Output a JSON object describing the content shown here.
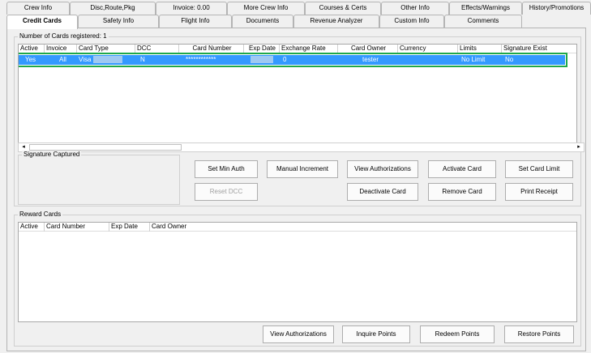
{
  "tabs_top": [
    {
      "label": "Crew Info",
      "active": false
    },
    {
      "label": "Disc,Route,Pkg",
      "active": false
    },
    {
      "label": "Invoice: 0.00",
      "active": false
    },
    {
      "label": "More Crew Info",
      "active": false
    },
    {
      "label": "Courses & Certs",
      "active": false
    },
    {
      "label": "Other Info",
      "active": false
    },
    {
      "label": "Effects/Warnings",
      "active": false
    },
    {
      "label": "History/Promotions",
      "active": false
    }
  ],
  "tabs_bottom": [
    {
      "label": "Credit Cards",
      "active": true
    },
    {
      "label": "Safety Info",
      "active": false
    },
    {
      "label": "Flight Info",
      "active": false
    },
    {
      "label": "Documents",
      "active": false
    },
    {
      "label": "Revenue Analyzer",
      "active": false
    },
    {
      "label": "Custom Info",
      "active": false
    },
    {
      "label": "Comments",
      "active": false
    }
  ],
  "cards_group": {
    "title": "Number of Cards registered: 1",
    "columns": [
      "Active",
      "Invoice",
      "Card Type",
      "DCC",
      "Card Number",
      "Exp Date",
      "Exchange Rate",
      "Card Owner",
      "Currency",
      "Limits",
      "Signature Exist"
    ],
    "rows": [
      {
        "active": "Yes",
        "invoice": "All",
        "card_type": "Visa",
        "dcc": "N",
        "card_number": "************",
        "exp_date": "",
        "exchange_rate": "0",
        "card_owner": "tester",
        "currency": "",
        "limits": "No Limit",
        "signature": "No"
      }
    ]
  },
  "signature": {
    "title": "Signature Captured"
  },
  "buttons": {
    "set_min_auth": "Set Min Auth",
    "manual_increment": "Manual Increment",
    "view_authorizations": "View Authorizations",
    "activate_card": "Activate Card",
    "set_card_limit": "Set Card Limit",
    "reset_dcc": "Reset DCC",
    "deactivate_card": "Deactivate Card",
    "remove_card": "Remove Card",
    "print_receipt": "Print Receipt"
  },
  "reward_group": {
    "title": "Reward Cards",
    "columns": [
      "Active",
      "Card Number",
      "Exp Date",
      "Card Owner"
    ]
  },
  "reward_buttons": {
    "view_authorizations": "View Authorizations",
    "inquire_points": "Inquire Points",
    "redeem_points": "Redeem Points",
    "restore_points": "Restore Points"
  },
  "scroll_arrows": {
    "left": "◂",
    "right": "▸"
  },
  "colors": {
    "selection": "#3399ff",
    "selection_outline": "#1fa84a"
  }
}
